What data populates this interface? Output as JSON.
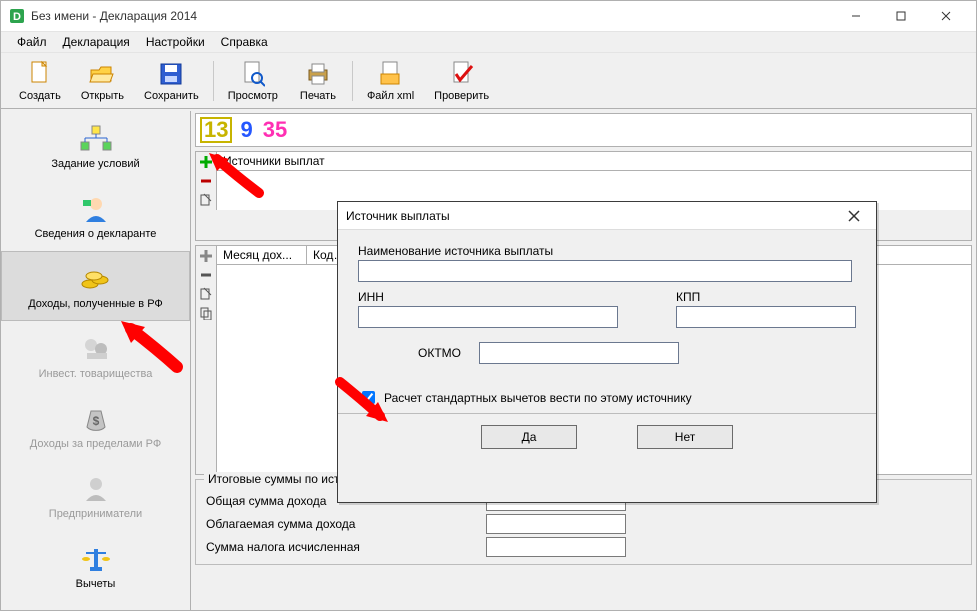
{
  "window": {
    "title": "Без имени - Декларация 2014"
  },
  "menu": {
    "file": "Файл",
    "decl": "Декларация",
    "settings": "Настройки",
    "help": "Справка"
  },
  "toolbar": {
    "create": "Создать",
    "open": "Открыть",
    "save": "Сохранить",
    "preview": "Просмотр",
    "print": "Печать",
    "filexml": "Файл xml",
    "check": "Проверить"
  },
  "rates": {
    "r13": "13",
    "r9": "9",
    "r35": "35"
  },
  "sidebar": {
    "conditions": "Задание условий",
    "declarant": "Сведения о декларанте",
    "income_rf": "Доходы, полученные в РФ",
    "invest": "Инвест. товарищества",
    "income_foreign": "Доходы за пределами РФ",
    "entr": "Предприниматели",
    "deduct": "Вычеты"
  },
  "panels": {
    "sources_header": "Источники выплат",
    "col_month": "Месяц дох...",
    "col_code": "Код…",
    "totals_legend": "Итоговые суммы по источнику выплат",
    "total_income": "Общая сумма дохода",
    "taxable_income": "Облагаемая сумма дохода",
    "tax_calc": "Сумма налога исчисленная"
  },
  "dialog": {
    "title": "Источник выплаты",
    "name_label": "Наименование источника выплаты",
    "inn": "ИНН",
    "kpp": "КПП",
    "oktmo": "ОКТМО",
    "checkbox": "Расчет стандартных вычетов вести по этому источнику",
    "yes": "Да",
    "no": "Нет",
    "values": {
      "name": "",
      "inn": "",
      "kpp": "",
      "oktmo": "",
      "std_calc": true
    }
  }
}
